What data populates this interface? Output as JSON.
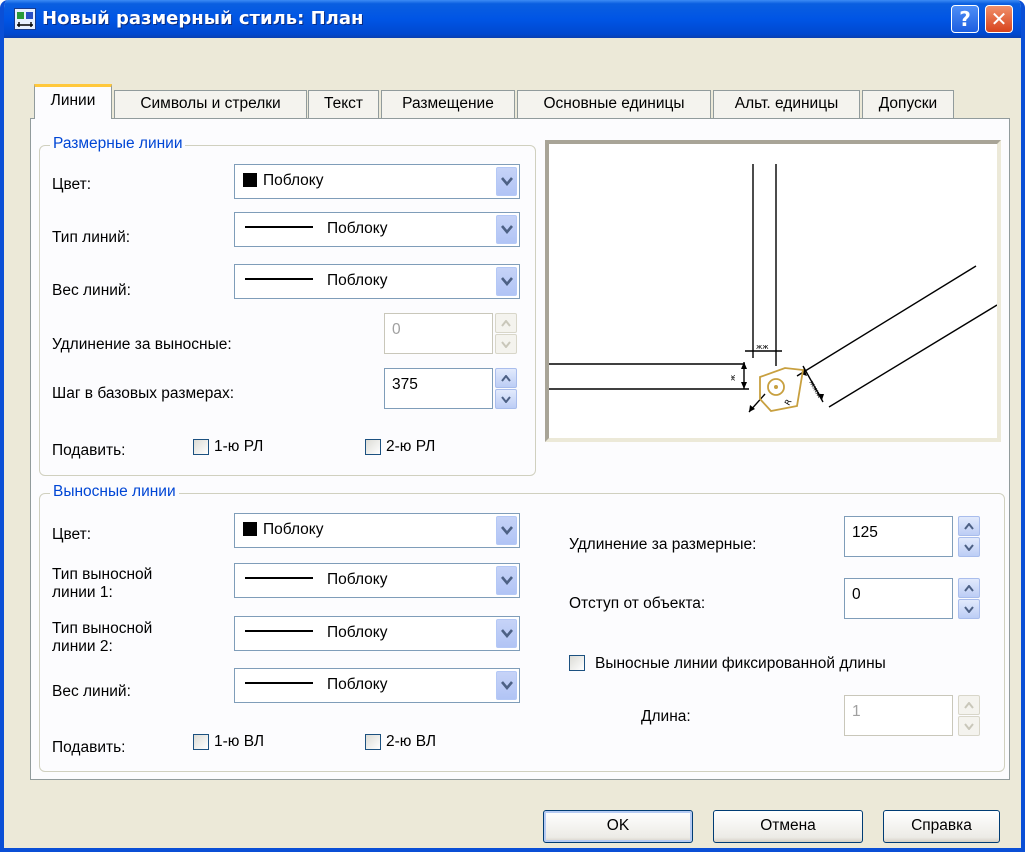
{
  "window": {
    "title": "Новый размерный стиль: План",
    "help_glyph": "?",
    "close_glyph": "✕"
  },
  "tabs": [
    "Линии",
    "Символы и стрелки",
    "Текст",
    "Размещение",
    "Основные единицы",
    "Альт. единицы",
    "Допуски"
  ],
  "dim_lines": {
    "title": "Размерные линии",
    "color_label": "Цвет:",
    "color_value": "Поблоку",
    "linetype_label": "Тип линий:",
    "linetype_value": "Поблоку",
    "lineweight_label": "Вес линий:",
    "lineweight_value": "Поблоку",
    "extension_label": "Удлинение за выносные:",
    "extension_value": "0",
    "baseline_label": "Шаг в базовых размерах:",
    "baseline_value": "375",
    "suppress_label": "Подавить:",
    "suppress_1": "1-ю РЛ",
    "suppress_2": "2-ю РЛ"
  },
  "ext_lines": {
    "title": "Выносные линии",
    "color_label": "Цвет:",
    "color_value": "Поблоку",
    "linetype1_label_1": "Тип выносной",
    "linetype1_label_2": "линии 1:",
    "linetype1_value": "Поблоку",
    "linetype2_label_1": "Тип выносной",
    "linetype2_label_2": "линии 2:",
    "linetype2_value": "Поблоку",
    "lineweight_label": "Вес линий:",
    "lineweight_value": "Поблоку",
    "suppress_label": "Подавить:",
    "suppress_1": "1-ю ВЛ",
    "suppress_2": "2-ю ВЛ",
    "extend_label": "Удлинение за размерные:",
    "extend_value": "125",
    "offset_label": "Отступ от объекта:",
    "offset_value": "0",
    "fixed_label": "Выносные линии фиксированной длины",
    "length_label": "Длина:",
    "length_value": "1"
  },
  "buttons": {
    "ok": "OK",
    "cancel": "Отмена",
    "help": "Справка"
  },
  "colors": {
    "title_bar": "#0055e5",
    "group_title": "#0046d5",
    "tab_highlight": "#ffc83c",
    "preview_accent": "#c8a040"
  }
}
